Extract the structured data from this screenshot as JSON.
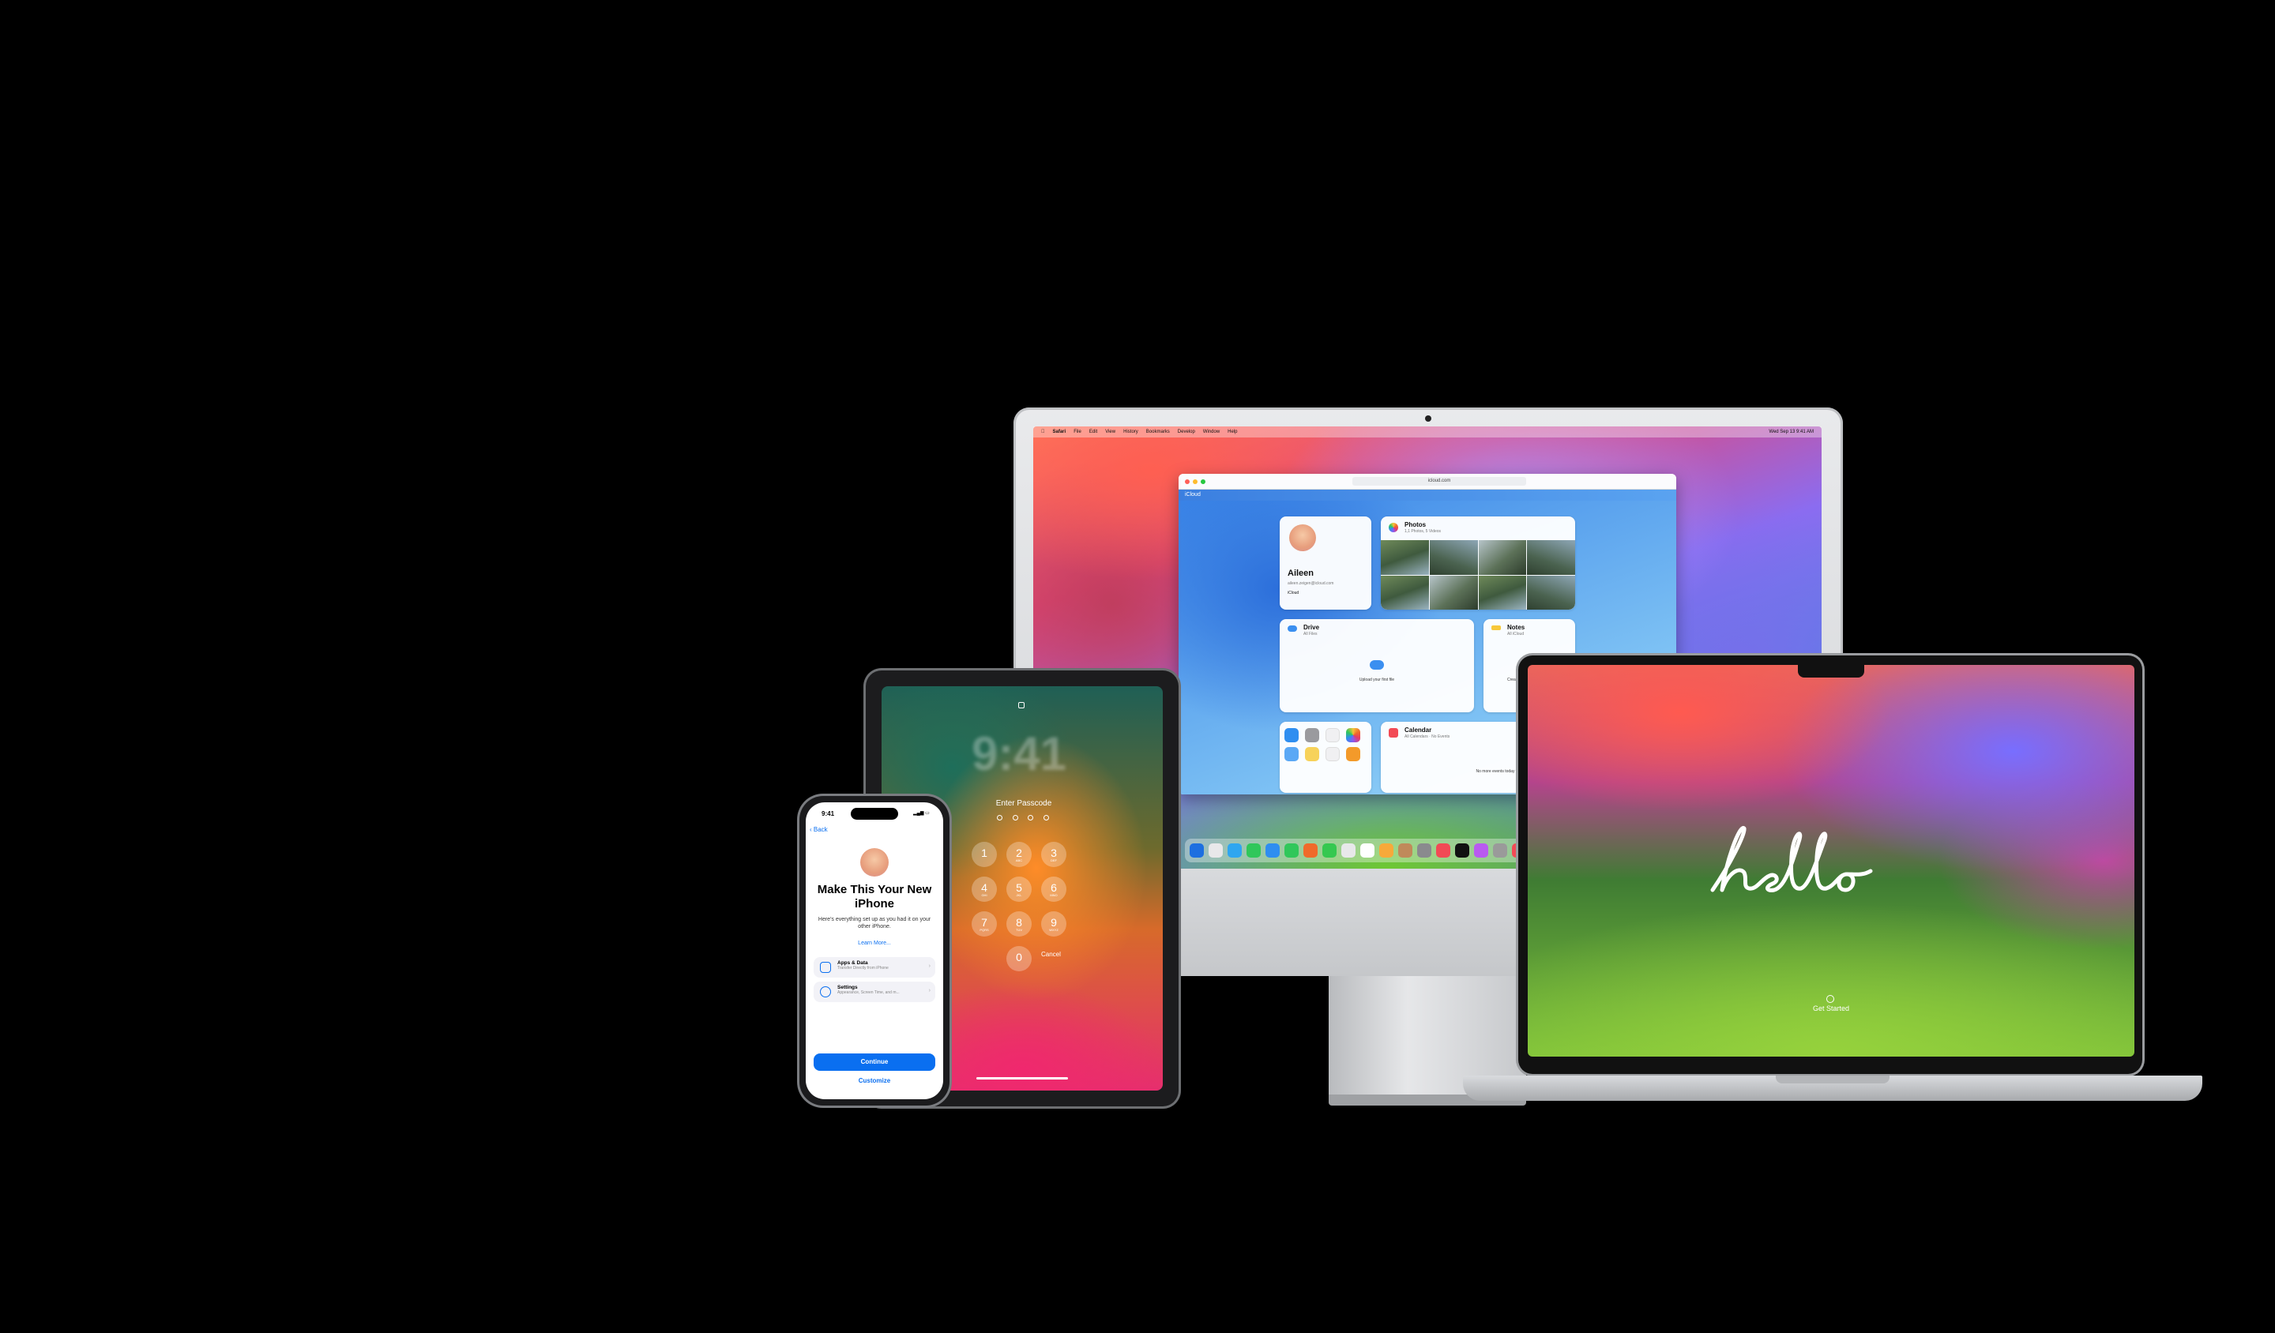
{
  "imac": {
    "menubar": {
      "items": [
        "Safari",
        "File",
        "Edit",
        "View",
        "History",
        "Bookmarks",
        "Develop",
        "Window",
        "Help"
      ],
      "clock": "Wed Sep 13 9:41 AM"
    },
    "safari": {
      "url": "icloud.com",
      "icloud_label": "iCloud"
    },
    "profile": {
      "name": "Aileen",
      "email": "aileen.zeigen@icloud.com",
      "account": "iCloud"
    },
    "photos": {
      "title": "Photos",
      "subtitle": "1,1 Photos, 5 Videos"
    },
    "drive": {
      "title": "Drive",
      "subtitle": "All Files",
      "upload_label": "Upload your first file"
    },
    "notes": {
      "title": "Notes",
      "subtitle": "All iCloud",
      "create_label": "Create"
    },
    "calendar": {
      "title": "Calendar",
      "subtitle": "All Calendars · No Events",
      "empty_label": "No more events today"
    },
    "apps": [
      "Mail",
      "Contacts",
      "Calendar",
      "Photos",
      "Drive",
      "Notes",
      "Reminders",
      "Pages"
    ],
    "dock_colors": [
      "#1d6fe0",
      "#e8e8ea",
      "#2fa6f0",
      "#30c75a",
      "#2f8ef0",
      "#30c75a",
      "#f06a2a",
      "#35c850",
      "#e8e8ea",
      "#ffffff",
      "#f7a93a",
      "#c08a5a",
      "#8a8a8e",
      "#f24a55",
      "#111111",
      "#b95af0",
      "#9a9a9a",
      "#f24a55",
      "#e8e8ea"
    ]
  },
  "macbook": {
    "greeting": "hello",
    "get_started": "Get Started"
  },
  "ipad": {
    "time": "9:41",
    "prompt": "Enter Passcode",
    "keys": [
      {
        "num": "1",
        "letters": ""
      },
      {
        "num": "2",
        "letters": "ABC"
      },
      {
        "num": "3",
        "letters": "DEF"
      },
      {
        "num": "4",
        "letters": "GHI"
      },
      {
        "num": "5",
        "letters": "JKL"
      },
      {
        "num": "6",
        "letters": "MNO"
      },
      {
        "num": "7",
        "letters": "PQRS"
      },
      {
        "num": "8",
        "letters": "TUV"
      },
      {
        "num": "9",
        "letters": "WXYZ"
      },
      {
        "num": "0",
        "letters": ""
      }
    ],
    "cancel": "Cancel"
  },
  "iphone": {
    "time": "9:41",
    "back": "Back",
    "title": "Make This Your New iPhone",
    "description": "Here's everything set up as you had it on your other iPhone.",
    "learn_more": "Learn More...",
    "rows": [
      {
        "title": "Apps & Data",
        "subtitle": "Transfer Directly from iPhone"
      },
      {
        "title": "Settings",
        "subtitle": "Appearance, Screen Time, and m..."
      }
    ],
    "continue": "Continue",
    "customize": "Customize"
  }
}
